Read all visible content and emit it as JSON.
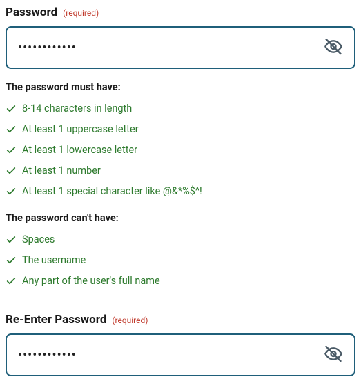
{
  "password_field": {
    "label": "Password",
    "required_tag": "(required)",
    "value": "••••••••••••"
  },
  "requirements": {
    "must_have_heading": "The password must have:",
    "must_have": [
      "8-14 characters in length",
      "At least 1 uppercase letter",
      "At least 1 lowercase letter",
      "At least 1 number",
      "At least 1 special character like @&*%$^!"
    ],
    "cant_have_heading": "The password can't have:",
    "cant_have": [
      "Spaces",
      "The username",
      "Any part of the user's full name"
    ]
  },
  "confirm_field": {
    "label": "Re-Enter Password",
    "required_tag": "(required)",
    "value": "••••••••••••"
  }
}
